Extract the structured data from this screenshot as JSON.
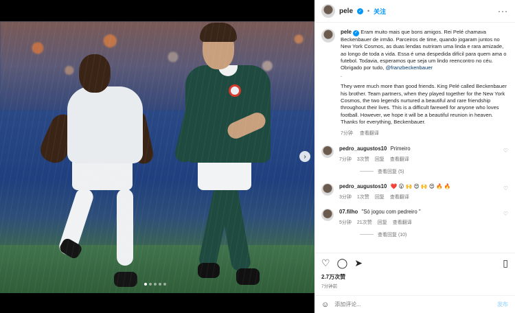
{
  "post": {
    "author": "pele",
    "follow_label": "关注",
    "separator": "•",
    "more_label": "···",
    "caption_pt": "Eram muito mais que bons amigos. Rei Pelé chamava Beckenbauer de irmão. Parceiros de time, quando jogaram juntos no New York Cosmos, as duas lendas nutriram uma linda e rara amizade, ao longo de toda a vida. Essa é uma despedida difícil para quem ama o futebol. Todavia, esperamos que seja um lindo reencontro no céu. Obrigado por tudo,",
    "mention": "@franzbeckenbauer",
    "dot_line": ".",
    "caption_en": "They were much more than good friends. King Pelé called Beckenbauer his brother. Team partners, when they played together for the New York Cosmos, the two legends nurtured a beautiful and rare friendship throughout their lives. This is a difficult farewell for anyone who loves football. However, we hope it will be a beautiful reunion in heaven. Thanks for everything, Beckenbauer.",
    "time": "7分钟",
    "translate": "查看翻译"
  },
  "comments": [
    {
      "user": "pedro_augustos10",
      "text": "Primeiro",
      "time": "7分钟",
      "likes": "3次赞",
      "reply": "回复",
      "translate": "查看翻译"
    },
    {
      "user": "pedro_augustos10",
      "text": "❤️ 😮 🙌 😍 🙌 😍 🔥 🔥",
      "time": "3分钟",
      "likes": "1次赞",
      "reply": "回复",
      "translate": "查看翻译"
    },
    {
      "user": "07.filho",
      "text": "\"Só jogou com pedreiro \"",
      "time": "5分钟",
      "likes": "21次赞",
      "reply": "回复",
      "translate": "查看翻译"
    }
  ],
  "replies_label": "查看回复 (5)",
  "replies_label_2": "查看回复 (10)",
  "actions": {
    "likes": "2.7万次赞",
    "ago": "7分钟前",
    "add_placeholder": "添加评论...",
    "post_label": "发布"
  },
  "icons": [
    "verified-icon",
    "heart-icon",
    "comment-icon",
    "share-icon",
    "bookmark-icon",
    "emoji-icon",
    "chevron-right-icon"
  ]
}
